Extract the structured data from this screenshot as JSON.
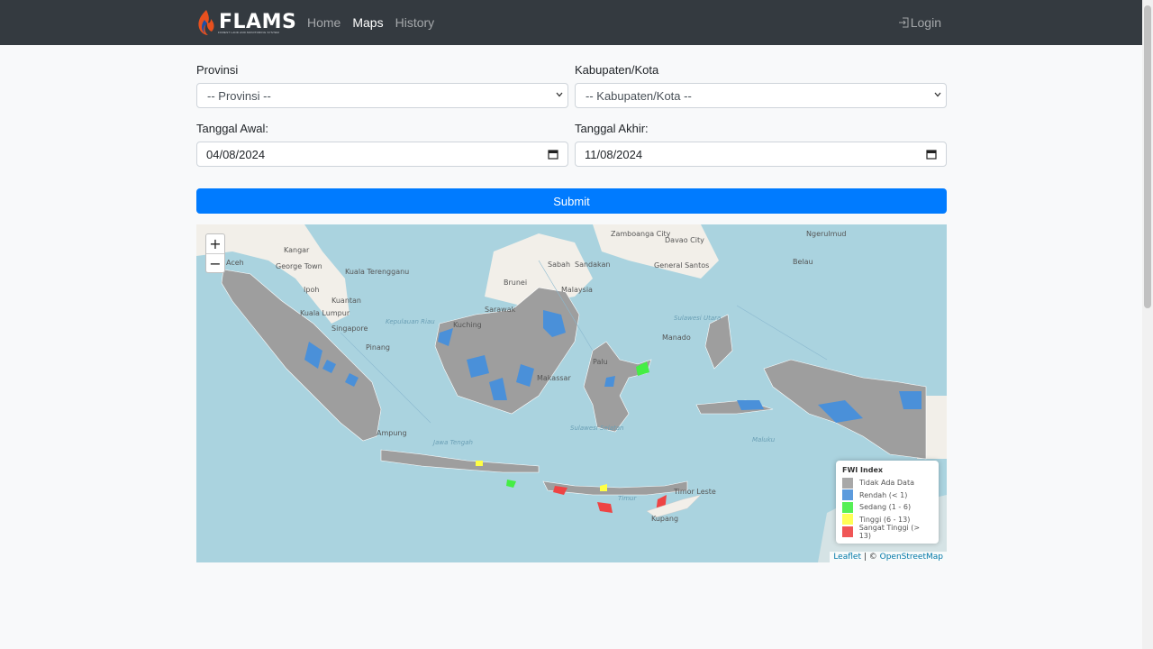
{
  "navbar": {
    "brand": "FLAMS",
    "brand_sub": "FOREST LAND AND MONITORING SYSTEM",
    "links": [
      {
        "label": "Home",
        "active": false
      },
      {
        "label": "Maps",
        "active": true
      },
      {
        "label": "History",
        "active": false
      }
    ],
    "login_label": "Login",
    "bg_color": "#343a40"
  },
  "form": {
    "provinsi_label": "Provinsi",
    "provinsi_selected": "-- Provinsi --",
    "kabupaten_label": "Kabupaten/Kota",
    "kabupaten_selected": "-- Kabupaten/Kota --",
    "tanggal_awal_label": "Tanggal Awal:",
    "tanggal_awal_value": "04/08/2024",
    "tanggal_akhir_label": "Tanggal Akhir:",
    "tanggal_akhir_value": "11/08/2024",
    "submit_label": "Submit",
    "submit_color": "#007bff"
  },
  "map": {
    "zoom_in": "+",
    "zoom_out": "−",
    "labels": [
      "Kangar",
      "George Town",
      "Kuala Terengganu",
      "Ipoh",
      "Kuantan",
      "Kuala Lumpur",
      "Singapore",
      "Pinang",
      "Aceh",
      "Brunei",
      "Sabah",
      "Sandakan",
      "Malaysia",
      "Zamboanga City",
      "Davao City",
      "General Santos",
      "Ngerulmud",
      "Belau",
      "Kuching",
      "Sarawak",
      "Palu",
      "Manado",
      "Makassar",
      "Ampung",
      "Timor Leste",
      "Kupang"
    ],
    "sea_labels": [
      "Kepulauan Riau",
      "Jawa Tengah",
      "Sulawesi Selatan",
      "Sulawesi Utara",
      "Maluku",
      "Timur"
    ],
    "legend": {
      "title": "FWI Index",
      "items": [
        {
          "label": "Tidak Ada Data",
          "color": "#9e9e9e"
        },
        {
          "label": "Rendah (< 1)",
          "color": "#4a90d9"
        },
        {
          "label": "Sedang (1 - 6)",
          "color": "#44ee44"
        },
        {
          "label": "Tinggi (6 - 13)",
          "color": "#ffff44"
        },
        {
          "label": "Sangat Tinggi (> 13)",
          "color": "#ee4444"
        }
      ]
    },
    "attribution_leaflet": "Leaflet",
    "attribution_sep": " | © ",
    "attribution_osm": "OpenStreetMap"
  }
}
